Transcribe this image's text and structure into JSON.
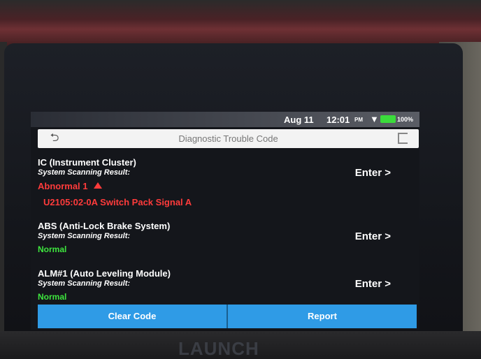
{
  "brand": "LAUNCH",
  "status_bar": {
    "date": "Aug 11",
    "time": "12:01",
    "ampm": "PM",
    "battery": "100%"
  },
  "header": {
    "title": "Diagnostic Trouble Code"
  },
  "systems": [
    {
      "name": "IC (Instrument Cluster)",
      "result_label": "System Scanning Result:",
      "status": "Abnormal 1",
      "dtc": "U2105:02-0A Switch Pack Signal A",
      "enter": "Enter >"
    },
    {
      "name": "ABS (Anti-Lock Brake System)",
      "result_label": "System Scanning Result:",
      "status": "Normal",
      "enter": "Enter >"
    },
    {
      "name": "ALM#1 (Auto Leveling Module)",
      "result_label": "System Scanning Result:",
      "status": "Normal",
      "enter": "Enter >"
    }
  ],
  "buttons": {
    "clear": "Clear Code",
    "report": "Report"
  }
}
